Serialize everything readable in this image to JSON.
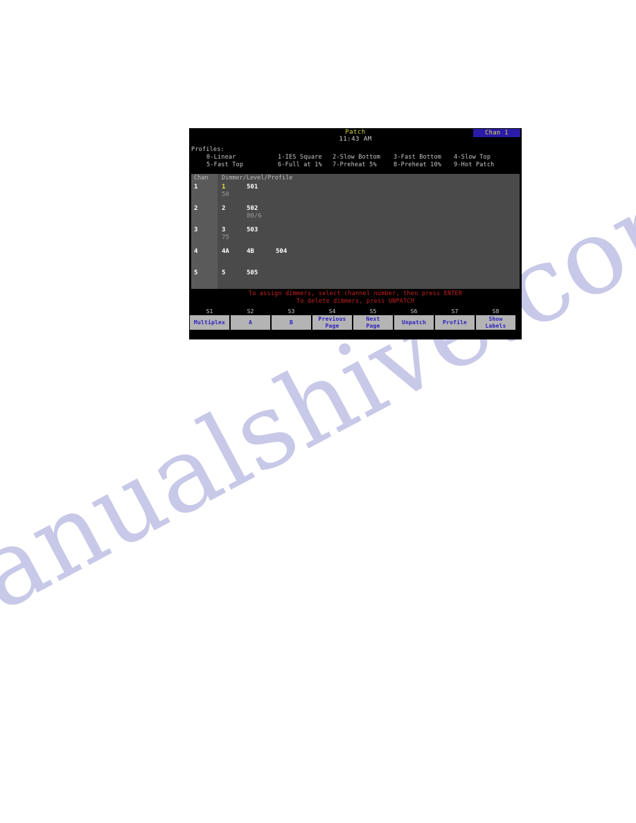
{
  "screen": {
    "title": "Patch",
    "clock": "11:43 AM",
    "channel_badge": "Chan 1",
    "colors": {
      "title": "#d8d84a",
      "badge_bg": "#2a1ca8",
      "badge_fg": "#e0e04a",
      "prompt": "#c92020",
      "softkey_bg": "#b4b4b4",
      "softkey_fg": "#2c1ec0",
      "highlight": "#e8e83c",
      "table_bg": "#4a4a4a",
      "chan_col_bg": "#5a5a5a"
    }
  },
  "profiles": {
    "heading": "Profiles:",
    "rows": [
      [
        "0-Linear",
        "1-IES Square",
        "2-Slow Bottom",
        "3-Fast Bottom",
        "4-Slow Top"
      ],
      [
        "5-Fast Top",
        "6-Full at 1%",
        "7-Preheat 5%",
        "8-Preheat 10%",
        "9-Hot Patch"
      ]
    ]
  },
  "table": {
    "headers": {
      "channel": "Chan",
      "dimmer": "Dimmer/Level/Profile"
    },
    "rows": [
      {
        "channel": "1",
        "dimmers": [
          {
            "name": "1",
            "highlight": true
          },
          {
            "name": "501",
            "highlight": false
          }
        ],
        "levels": [
          {
            "value": "50",
            "col": 0
          }
        ]
      },
      {
        "channel": "2",
        "dimmers": [
          {
            "name": "2",
            "highlight": false
          },
          {
            "name": "502",
            "highlight": false
          }
        ],
        "levels": [
          {
            "value": "80/6",
            "col": 1
          }
        ]
      },
      {
        "channel": "3",
        "dimmers": [
          {
            "name": "3",
            "highlight": false
          },
          {
            "name": "503",
            "highlight": false
          }
        ],
        "levels": [
          {
            "value": "75",
            "col": 0
          }
        ]
      },
      {
        "channel": "4",
        "dimmers": [
          {
            "name": "4A",
            "highlight": false
          },
          {
            "name": "4B",
            "highlight": false
          },
          {
            "name": "504",
            "highlight": false
          }
        ],
        "levels": []
      },
      {
        "channel": "5",
        "dimmers": [
          {
            "name": "5",
            "highlight": false
          },
          {
            "name": "505",
            "highlight": false
          }
        ],
        "levels": []
      }
    ]
  },
  "prompts": {
    "line1": "To assign dimmers, select channel number, then press ENTER",
    "line2": "To delete dimmers, press UNPATCH"
  },
  "softkeys": [
    {
      "id": "S1",
      "lines": [
        "Multiplex"
      ]
    },
    {
      "id": "S2",
      "lines": [
        "A"
      ]
    },
    {
      "id": "S3",
      "lines": [
        "B"
      ]
    },
    {
      "id": "S4",
      "lines": [
        "Previous",
        "Page"
      ]
    },
    {
      "id": "S5",
      "lines": [
        "Next",
        "Page"
      ]
    },
    {
      "id": "S6",
      "lines": [
        "Unpatch"
      ]
    },
    {
      "id": "S7",
      "lines": [
        "Profile"
      ]
    },
    {
      "id": "S8",
      "lines": [
        "Show",
        "Labels"
      ]
    }
  ],
  "watermark": {
    "text": "manualshive.com"
  }
}
